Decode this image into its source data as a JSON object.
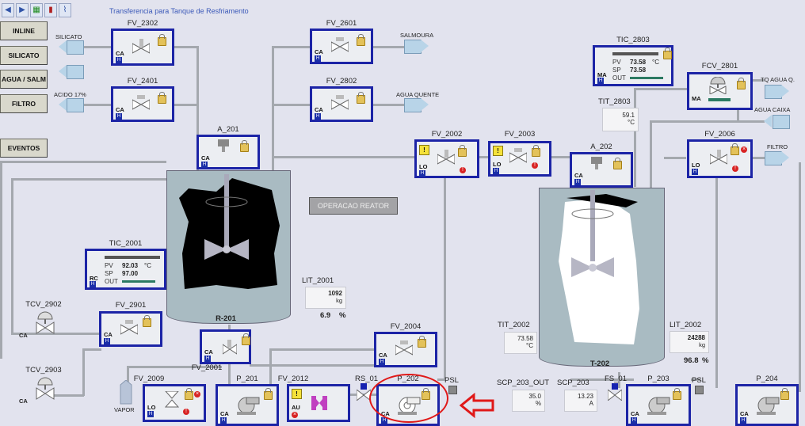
{
  "window": {
    "title": "Transferencia para Tanque de Resfriamento"
  },
  "toolbar": {
    "icons": [
      "back-icon",
      "forward-icon",
      "grid-icon",
      "trend-icon",
      "chart-icon"
    ]
  },
  "nav": {
    "inline": "INLINE",
    "silicato": "SILICATO",
    "agua_salm": "AGUA / SALM",
    "filtro": "FILTRO",
    "eventos": "EVENTOS"
  },
  "sources": {
    "silicato": "SILICATO",
    "acido": "ACIDO 17%",
    "salmoura": "SALMOURA",
    "agua_quente": "AGUA QUENTE",
    "tq_agua": "TQ AGUA Q.",
    "agua_caixa": "AGUA CAIXA",
    "filtro": "FILTRO",
    "vapor": "VAPOR"
  },
  "valves": {
    "fv2302": {
      "label": "FV_2302",
      "mode": "CA"
    },
    "fv2401": {
      "label": "FV_2401",
      "mode": "CA"
    },
    "fv2601": {
      "label": "FV_2601",
      "mode": "CA"
    },
    "fv2802": {
      "label": "FV_2802",
      "mode": "CA"
    },
    "a201": {
      "label": "A_201",
      "mode": "CA"
    },
    "fv2002": {
      "label": "FV_2002",
      "mode": "LO"
    },
    "fv2003": {
      "label": "FV_2003",
      "mode": "LO"
    },
    "a202": {
      "label": "A_202",
      "mode": "CA"
    },
    "fcv2801": {
      "label": "FCV_2801",
      "mode": "MA"
    },
    "fv2006": {
      "label": "FV_2006",
      "mode": "LO"
    },
    "fv2901": {
      "label": "FV_2901",
      "mode": "CA"
    },
    "fv2001": {
      "label": "FV_2001",
      "mode": "CA"
    },
    "fv2004": {
      "label": "FV_2004",
      "mode": "CA"
    },
    "fv2009": {
      "label": "FV_2009",
      "mode": "LO"
    },
    "fv2012": {
      "label": "FV_2012",
      "mode": "AU"
    },
    "p201": {
      "label": "P_201",
      "mode": "CA"
    },
    "p202": {
      "label": "P_202",
      "mode": "CA"
    },
    "p203": {
      "label": "P_203",
      "mode": "CA"
    },
    "p204": {
      "label": "P_204",
      "mode": "CA"
    },
    "tcv2902": {
      "label": "TCV_2902",
      "mode": "CA"
    },
    "tcv2903": {
      "label": "TCV_2903",
      "mode": "CA"
    },
    "rs01": {
      "label": "RS_01"
    },
    "fs01": {
      "label": "FS_01"
    }
  },
  "tic2001": {
    "label": "TIC_2001",
    "mode": "RC",
    "pv_label": "PV",
    "pv": "92.03",
    "unit": "°C",
    "sp_label": "SP",
    "sp": "97.00",
    "out_label": "OUT"
  },
  "tic2803": {
    "label": "TIC_2803",
    "mode": "MA",
    "pv_label": "PV",
    "pv": "73.58",
    "unit": "°C",
    "sp_label": "SP",
    "sp": "73.58",
    "out_label": "OUT"
  },
  "tit2803": {
    "label": "TIT_2803",
    "value": "59.1",
    "unit": "°C"
  },
  "tit2002": {
    "label": "TIT_2002",
    "value": "73.58",
    "unit": "°C"
  },
  "lit2001": {
    "label": "LIT_2001",
    "value": "1092",
    "unit": "kg",
    "pct": "6.9",
    "pct_unit": "%"
  },
  "lit2002": {
    "label": "LIT_2002",
    "value": "24288",
    "unit": "kg",
    "pct": "96.8",
    "pct_unit": "%"
  },
  "scp203out": {
    "label": "SCP_203_OUT",
    "value": "35.0",
    "unit": "%"
  },
  "scp203": {
    "label": "SCP_203",
    "value": "13.23",
    "unit": "A"
  },
  "psl1": {
    "label": "PSL"
  },
  "psl2": {
    "label": "PSL"
  },
  "reactor1": {
    "label": "R-201"
  },
  "reactor2": {
    "label": "T-202"
  },
  "op_button": "OPERACAO REATOR",
  "colors": {
    "device_border": "#1c24a6",
    "vessel": "#a9bbc2",
    "highlight_red": "#e01818",
    "pipe": "#a4a8ae"
  }
}
